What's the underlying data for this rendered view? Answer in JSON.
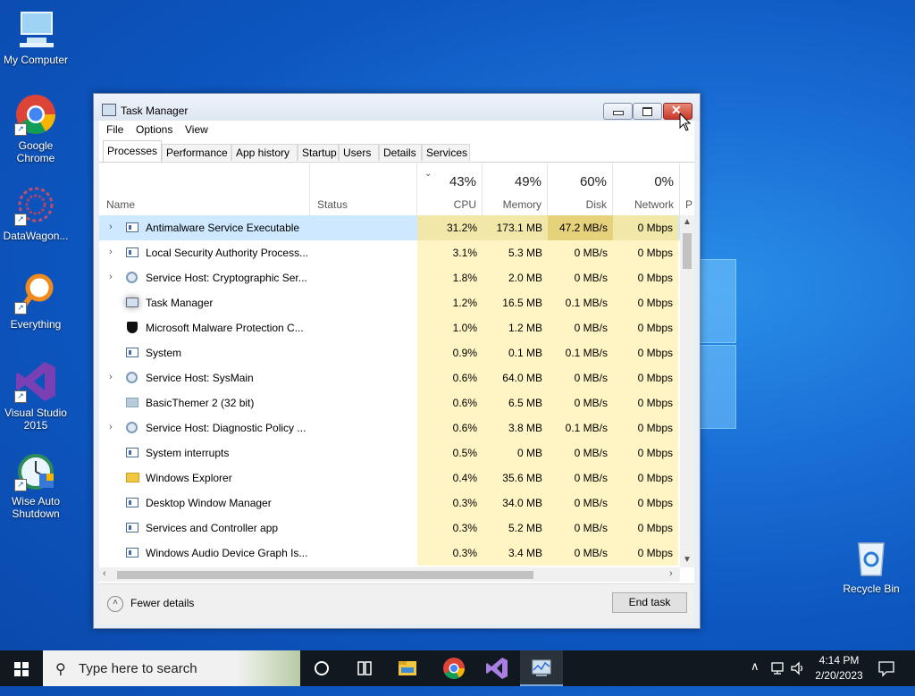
{
  "desktop": {
    "icons": [
      {
        "label": "My Computer"
      },
      {
        "label": "Google Chrome"
      },
      {
        "label": "DataWagon..."
      },
      {
        "label": "Everything"
      },
      {
        "label": "Visual Studio 2015"
      },
      {
        "label": "Wise Auto Shutdown"
      },
      {
        "label": "Recycle Bin"
      }
    ]
  },
  "window": {
    "title": "Task Manager",
    "menu": [
      "File",
      "Options",
      "View"
    ],
    "tabs": [
      "Processes",
      "Performance",
      "App history",
      "Startup",
      "Users",
      "Details",
      "Services"
    ],
    "active_tab": "Processes",
    "columns": {
      "name": "Name",
      "status": "Status",
      "cpu": {
        "pct": "43%",
        "label": "CPU"
      },
      "memory": {
        "pct": "49%",
        "label": "Memory"
      },
      "disk": {
        "pct": "60%",
        "label": "Disk"
      },
      "network": {
        "pct": "0%",
        "label": "Network"
      },
      "power": "P"
    },
    "processes": [
      {
        "name": "Antimalware Service Executable",
        "cpu": "31.2%",
        "mem": "173.1 MB",
        "disk": "47.2 MB/s",
        "net": "0 Mbps",
        "expandable": true,
        "icon": "app-icon"
      },
      {
        "name": "Local Security Authority Process...",
        "cpu": "3.1%",
        "mem": "5.3 MB",
        "disk": "0 MB/s",
        "net": "0 Mbps",
        "expandable": true,
        "icon": "app-icon"
      },
      {
        "name": "Service Host: Cryptographic Ser...",
        "cpu": "1.8%",
        "mem": "2.0 MB",
        "disk": "0 MB/s",
        "net": "0 Mbps",
        "expandable": true,
        "icon": "gear-icon"
      },
      {
        "name": "Task Manager",
        "cpu": "1.2%",
        "mem": "16.5 MB",
        "disk": "0.1 MB/s",
        "net": "0 Mbps",
        "expandable": false,
        "icon": "task-manager-icon"
      },
      {
        "name": "Microsoft Malware Protection C...",
        "cpu": "1.0%",
        "mem": "1.2 MB",
        "disk": "0 MB/s",
        "net": "0 Mbps",
        "expandable": false,
        "icon": "shield-icon"
      },
      {
        "name": "System",
        "cpu": "0.9%",
        "mem": "0.1 MB",
        "disk": "0.1 MB/s",
        "net": "0 Mbps",
        "expandable": false,
        "icon": "app-icon"
      },
      {
        "name": "Service Host: SysMain",
        "cpu": "0.6%",
        "mem": "64.0 MB",
        "disk": "0 MB/s",
        "net": "0 Mbps",
        "expandable": true,
        "icon": "gear-icon"
      },
      {
        "name": "BasicThemer 2 (32 bit)",
        "cpu": "0.6%",
        "mem": "6.5 MB",
        "disk": "0 MB/s",
        "net": "0 Mbps",
        "expandable": false,
        "icon": "basicthemer-icon"
      },
      {
        "name": "Service Host: Diagnostic Policy ...",
        "cpu": "0.6%",
        "mem": "3.8 MB",
        "disk": "0.1 MB/s",
        "net": "0 Mbps",
        "expandable": true,
        "icon": "gear-icon"
      },
      {
        "name": "System interrupts",
        "cpu": "0.5%",
        "mem": "0 MB",
        "disk": "0 MB/s",
        "net": "0 Mbps",
        "expandable": false,
        "icon": "app-icon"
      },
      {
        "name": "Windows Explorer",
        "cpu": "0.4%",
        "mem": "35.6 MB",
        "disk": "0 MB/s",
        "net": "0 Mbps",
        "expandable": false,
        "icon": "folder-icon"
      },
      {
        "name": "Desktop Window Manager",
        "cpu": "0.3%",
        "mem": "34.0 MB",
        "disk": "0 MB/s",
        "net": "0 Mbps",
        "expandable": false,
        "icon": "app-icon"
      },
      {
        "name": "Services and Controller app",
        "cpu": "0.3%",
        "mem": "5.2 MB",
        "disk": "0 MB/s",
        "net": "0 Mbps",
        "expandable": false,
        "icon": "app-icon"
      },
      {
        "name": "Windows Audio Device Graph Is...",
        "cpu": "0.3%",
        "mem": "3.4 MB",
        "disk": "0 MB/s",
        "net": "0 Mbps",
        "expandable": false,
        "icon": "app-icon"
      }
    ],
    "footer": {
      "fewer_details": "Fewer details",
      "end_task": "End task"
    }
  },
  "taskbar": {
    "search_placeholder": "Type here to search",
    "time": "4:14 PM",
    "date": "2/20/2023"
  },
  "colors": {
    "accent": "#0d56c0",
    "selection": "#cde8ff",
    "heat": "#fff4c4"
  }
}
